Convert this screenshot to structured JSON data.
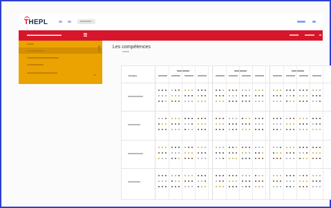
{
  "header": {
    "logo": "THEPL",
    "logo_parts": [
      "T",
      "HEPL"
    ],
    "nav_icons": [
      "home-icon",
      "arrow-icon"
    ],
    "user_icons": [
      "user-icon",
      "logout-icon"
    ]
  },
  "app_bar": {
    "menu_icon": "hamburger-icon",
    "colors": {
      "bar": "#d7162b",
      "sidebar": "#eaa300"
    }
  },
  "main": {
    "title": "Les compétences"
  },
  "competence_table": {
    "row_header": "Étudiant",
    "group_count": 3,
    "subcolumns_per_group": 4,
    "row_count": 4,
    "symbol_colors": [
      "#7a4a2b",
      "#3b4a5a",
      "#c9b23a",
      "#9aa6b0"
    ]
  }
}
